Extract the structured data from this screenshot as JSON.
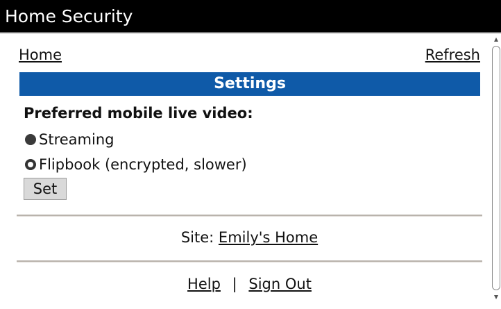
{
  "window": {
    "title": "Home Security"
  },
  "nav": {
    "home_label": "Home",
    "refresh_label": "Refresh"
  },
  "settings": {
    "header": "Settings",
    "video_pref_label": "Preferred mobile live video:",
    "options": [
      {
        "label": "Streaming",
        "selected": true
      },
      {
        "label": "Flipbook (encrypted, slower)",
        "selected": false
      }
    ],
    "set_button_label": "Set"
  },
  "site": {
    "prefix": "Site:",
    "name": "Emily's Home"
  },
  "footer": {
    "help_label": "Help",
    "separator": "|",
    "signout_label": "Sign Out"
  },
  "colors": {
    "header_bg": "#0f5aa8",
    "titlebar_bg": "#000000",
    "divider": "#b9b3ac"
  },
  "icons": {
    "selected_radio": "radio-filled-icon",
    "unselected_radio": "radio-empty-icon",
    "scroll_up": "scroll-up-arrow-icon",
    "scroll_down": "scroll-down-arrow-icon"
  }
}
